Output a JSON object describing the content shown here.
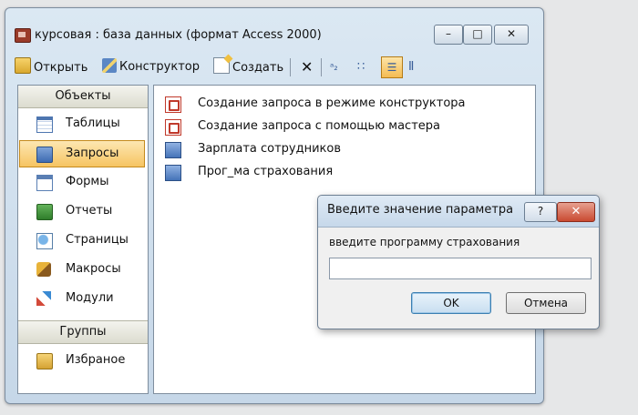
{
  "window": {
    "title": "курсовая : база данных (формат Access 2000)",
    "minimize": "–",
    "maximize": "□",
    "close": "✕"
  },
  "toolbar": {
    "open": "Открыть",
    "design": "Конструктор",
    "create": "Создать",
    "delete": "✕",
    "large_icons": "ᵃ₂",
    "small_icons": "∷",
    "list": "☰",
    "details": "Ⅱ"
  },
  "sidebar": {
    "objects_header": "Объекты",
    "items": [
      {
        "label": "Таблицы",
        "icon": "table-icon"
      },
      {
        "label": "Запросы",
        "icon": "query-icon"
      },
      {
        "label": "Формы",
        "icon": "form-icon"
      },
      {
        "label": "Отчеты",
        "icon": "report-icon"
      },
      {
        "label": "Страницы",
        "icon": "page-icon"
      },
      {
        "label": "Макросы",
        "icon": "macro-icon"
      },
      {
        "label": "Модули",
        "icon": "module-icon"
      }
    ],
    "selected": "Запросы",
    "groups_header": "Группы",
    "groups": [
      {
        "label": "Избраное",
        "icon": "favorites-folder-icon"
      }
    ]
  },
  "queries": [
    {
      "label": "Создание запроса в режиме конструктора",
      "icon": "design-wizard-icon"
    },
    {
      "label": "Создание запроса с помощью мастера",
      "icon": "wizard-icon"
    },
    {
      "label": "Зарплата сотрудников",
      "icon": "query-icon"
    },
    {
      "label": "Прог_ма страхования",
      "icon": "query-icon"
    }
  ],
  "dialog": {
    "title": "Введите значение параметра",
    "help": "?",
    "close": "✕",
    "prompt": "введите программу страхования",
    "input_value": "",
    "ok": "OK",
    "cancel": "Отмена"
  }
}
